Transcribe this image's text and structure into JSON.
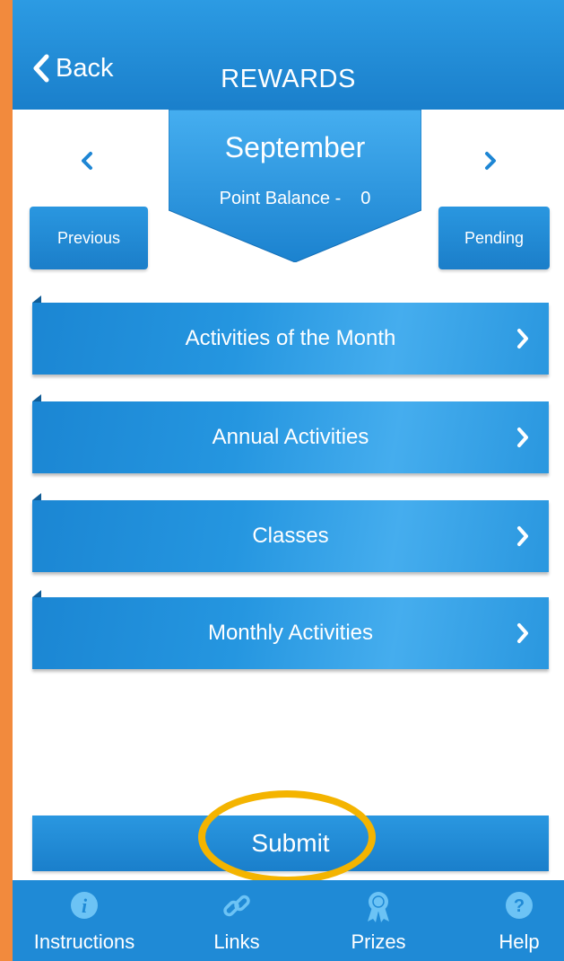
{
  "header": {
    "back_label": "Back",
    "title": "REWARDS"
  },
  "month_banner": {
    "month": "September",
    "balance_label": "Point Balance -",
    "balance_value": "0"
  },
  "nav": {
    "previous_label": "Previous",
    "pending_label": "Pending"
  },
  "categories": [
    {
      "label": "Activities of the Month"
    },
    {
      "label": "Annual Activities"
    },
    {
      "label": "Classes"
    },
    {
      "label": "Monthly Activities"
    }
  ],
  "submit_label": "Submit",
  "tabs": [
    {
      "label": "Instructions",
      "icon": "info-icon"
    },
    {
      "label": "Links",
      "icon": "link-icon"
    },
    {
      "label": "Prizes",
      "icon": "ribbon-icon"
    },
    {
      "label": "Help",
      "icon": "help-icon"
    }
  ],
  "colors": {
    "primary_blue": "#1f8ad6",
    "highlight": "#f4b400",
    "frame": "#f28a3d",
    "tab_icon": "#6cc3f5"
  }
}
